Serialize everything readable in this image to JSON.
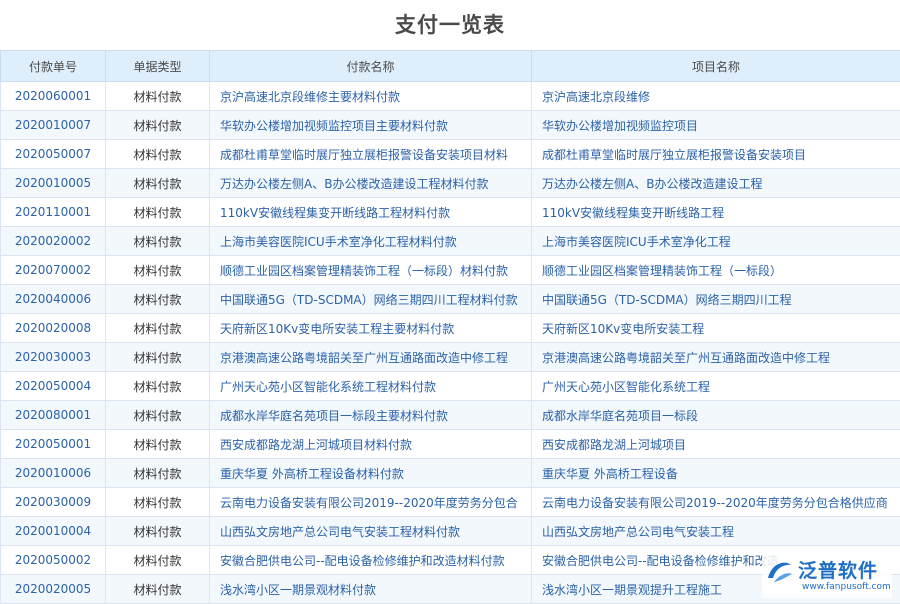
{
  "page": {
    "title": "支付一览表"
  },
  "table": {
    "headers": [
      "付款单号",
      "单据类型",
      "付款名称",
      "项目名称"
    ],
    "rows": [
      [
        "2020060001",
        "材料付款",
        "京沪高速北京段维修主要材料付款",
        "京沪高速北京段维修"
      ],
      [
        "2020010007",
        "材料付款",
        "华软办公楼增加视频监控项目主要材料付款",
        "华软办公楼增加视频监控项目"
      ],
      [
        "2020050007",
        "材料付款",
        "成都杜甫草堂临时展厅独立展柜报警设备安装项目材料",
        "成都杜甫草堂临时展厅独立展柜报警设备安装项目"
      ],
      [
        "2020010005",
        "材料付款",
        "万达办公楼左侧A、B办公楼改造建设工程材料付款",
        "万达办公楼左侧A、B办公楼改造建设工程"
      ],
      [
        "2020110001",
        "材料付款",
        "110kV安徽线程集变开断线路工程材料付款",
        "110kV安徽线程集变开断线路工程"
      ],
      [
        "2020020002",
        "材料付款",
        "上海市美容医院ICU手术室净化工程材料付款",
        "上海市美容医院ICU手术室净化工程"
      ],
      [
        "2020070002",
        "材料付款",
        "顺德工业园区档案管理精装饰工程（一标段）材料付款",
        "顺德工业园区档案管理精装饰工程（一标段）"
      ],
      [
        "2020040006",
        "材料付款",
        "中国联通5G（TD-SCDMA）网络三期四川工程材料付款",
        "中国联通5G（TD-SCDMA）网络三期四川工程"
      ],
      [
        "2020020008",
        "材料付款",
        "天府新区10Kv变电所安装工程主要材料付款",
        "天府新区10Kv变电所安装工程"
      ],
      [
        "2020030003",
        "材料付款",
        "京港澳高速公路粤境韶关至广州互通路面改造中修工程",
        "京港澳高速公路粤境韶关至广州互通路面改造中修工程"
      ],
      [
        "2020050004",
        "材料付款",
        "广州天心苑小区智能化系统工程材料付款",
        "广州天心苑小区智能化系统工程"
      ],
      [
        "2020080001",
        "材料付款",
        "成都水岸华庭名苑项目一标段主要材料付款",
        "成都水岸华庭名苑项目一标段"
      ],
      [
        "2020050001",
        "材料付款",
        "西安成都路龙湖上河城项目材料付款",
        "西安成都路龙湖上河城项目"
      ],
      [
        "2020010006",
        "材料付款",
        "重庆华夏 外高桥工程设备材料付款",
        "重庆华夏 外高桥工程设备"
      ],
      [
        "2020030009",
        "材料付款",
        "云南电力设备安装有限公司2019--2020年度劳务分包合",
        "云南电力设备安装有限公司2019--2020年度劳务分包合格供应商"
      ],
      [
        "2020010004",
        "材料付款",
        "山西弘文房地产总公司电气安装工程材料付款",
        "山西弘文房地产总公司电气安装工程"
      ],
      [
        "2020050002",
        "材料付款",
        "安徽合肥供电公司--配电设备检修维护和改造材料付款",
        "安徽合肥供电公司--配电设备检修维护和改造"
      ],
      [
        "2020020005",
        "材料付款",
        "浅水湾小区一期景观材料付款",
        "浅水湾小区一期景观提升工程施工"
      ]
    ]
  },
  "watermark": {
    "brand": "泛普软件",
    "url": "www.fanpusoft.com",
    "color": "#1f6fc4"
  }
}
